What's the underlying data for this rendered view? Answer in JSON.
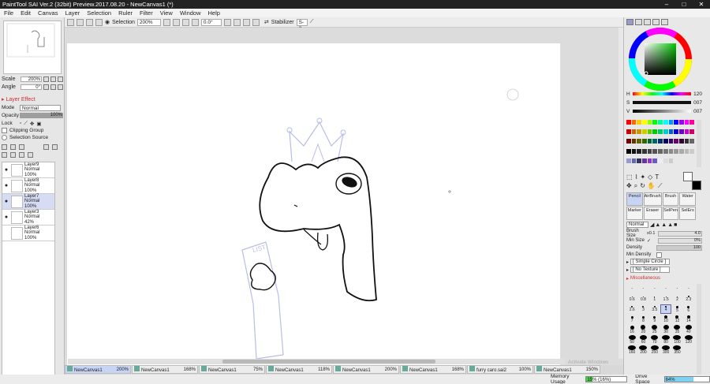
{
  "window": {
    "title": "PaintTool SAI Ver.2 (32bit) Preview.2017.08.20 - NewCanvas1 (*)"
  },
  "menu": [
    "File",
    "Edit",
    "Canvas",
    "Layer",
    "Selection",
    "Ruler",
    "Filter",
    "View",
    "Window",
    "Help"
  ],
  "toolbar": {
    "selection_label": "Selection",
    "zoom": "200%",
    "angle": "0.0°",
    "stabilizer_label": "Stabilizer",
    "stabilizer_value": "S-2"
  },
  "navigator": {
    "scale_label": "Scale",
    "scale_value": "200%",
    "angle_label": "Angle",
    "angle_value": "0°"
  },
  "layer_panel": {
    "effect_label": "Layer Effect",
    "mode_label": "Mode",
    "mode_value": "Normal",
    "opacity_label": "Opacity",
    "opacity_value": "100%",
    "lock_label": "Lock",
    "clipping_label": "Clipping Group",
    "selection_source_label": "Selection Source",
    "layers": [
      {
        "name": "Layer9",
        "mode": "Normal",
        "opacity": "100%"
      },
      {
        "name": "Layer8",
        "mode": "Normal",
        "opacity": "100%"
      },
      {
        "name": "Layer7",
        "mode": "Normal",
        "opacity": "100%"
      },
      {
        "name": "Layer3",
        "mode": "Normal",
        "opacity": "42%"
      },
      {
        "name": "Layer6",
        "mode": "Normal",
        "opacity": "100%"
      }
    ]
  },
  "color": {
    "h_label": "H",
    "h_value": "120",
    "s_label": "S",
    "s_value": "007",
    "v_label": "V",
    "v_value": "007",
    "accent": "#6a5acd"
  },
  "tools": [
    {
      "name": "Pencil"
    },
    {
      "name": "AirBrush"
    },
    {
      "name": "Brush"
    },
    {
      "name": "Water"
    },
    {
      "name": "Marker"
    },
    {
      "name": "Eraser"
    },
    {
      "name": "SelPen"
    },
    {
      "name": "SelErs"
    }
  ],
  "brush": {
    "blend_mode": "Normal",
    "size_label": "Brush Size",
    "size_mult": "x0.1",
    "size_value": "4.0",
    "min_size_label": "Min Size",
    "min_size_value": "0%",
    "density_label": "Density",
    "density_value": "100",
    "min_density_label": "Min Density",
    "shape": "[ Simple Circle ]",
    "texture": "[ No Texture ]",
    "misc_label": "Miscellaneous"
  },
  "brush_sizes": [
    {
      "label": "-",
      "d": 0
    },
    {
      "label": "-",
      "d": 0
    },
    {
      "label": "-",
      "d": 0
    },
    {
      "label": "-",
      "d": 0
    },
    {
      "label": "-",
      "d": 0
    },
    {
      "label": "-",
      "d": 0
    },
    {
      "label": "0.6",
      "d": 1
    },
    {
      "label": "0.8",
      "d": 1
    },
    {
      "label": "1",
      "d": 1
    },
    {
      "label": "1.5",
      "d": 1
    },
    {
      "label": "2",
      "d": 1
    },
    {
      "label": "2.3",
      "d": 2
    },
    {
      "label": "2.6",
      "d": 2
    },
    {
      "label": "3",
      "d": 2
    },
    {
      "label": "3.5",
      "d": 2
    },
    {
      "label": "4",
      "d": 2
    },
    {
      "label": "5",
      "d": 3
    },
    {
      "label": "6",
      "d": 3
    },
    {
      "label": "7",
      "d": 3
    },
    {
      "label": "8",
      "d": 3
    },
    {
      "label": "9",
      "d": 3
    },
    {
      "label": "10",
      "d": 4
    },
    {
      "label": "12",
      "d": 4
    },
    {
      "label": "14",
      "d": 4
    },
    {
      "label": "16",
      "d": 5
    },
    {
      "label": "20",
      "d": 6
    },
    {
      "label": "25",
      "d": 7
    },
    {
      "label": "30",
      "d": 7
    },
    {
      "label": "35",
      "d": 8
    },
    {
      "label": "40",
      "d": 8
    },
    {
      "label": "50",
      "d": 9
    },
    {
      "label": "60",
      "d": 9
    },
    {
      "label": "70",
      "d": 9
    },
    {
      "label": "80",
      "d": 10
    },
    {
      "label": "100",
      "d": 10
    },
    {
      "label": "120",
      "d": 10
    },
    {
      "label": "160",
      "d": 10
    },
    {
      "label": "200",
      "d": 10
    },
    {
      "label": "250",
      "d": 10
    },
    {
      "label": "300",
      "d": 10
    },
    {
      "label": "350",
      "d": 10
    }
  ],
  "tabs": [
    {
      "name": "NewCanvas1",
      "zoom": "200%"
    },
    {
      "name": "NewCanvas1",
      "zoom": "168%"
    },
    {
      "name": "NewCanvas1",
      "zoom": "75%"
    },
    {
      "name": "NewCanvas1",
      "zoom": "118%"
    },
    {
      "name": "NewCanvas1",
      "zoom": "200%"
    },
    {
      "name": "NewCanvas1",
      "zoom": "168%"
    },
    {
      "name": "furry caro.sai2",
      "zoom": "100%"
    },
    {
      "name": "NewCanvas1",
      "zoom": "150%"
    }
  ],
  "status": {
    "memory_label": "Memory Usage",
    "memory_value": "15% (16%)",
    "memory_pct": 15,
    "drive_label": "Drive Space",
    "drive_value": "64%",
    "drive_pct": 64
  },
  "watermark": "Activate Windows"
}
